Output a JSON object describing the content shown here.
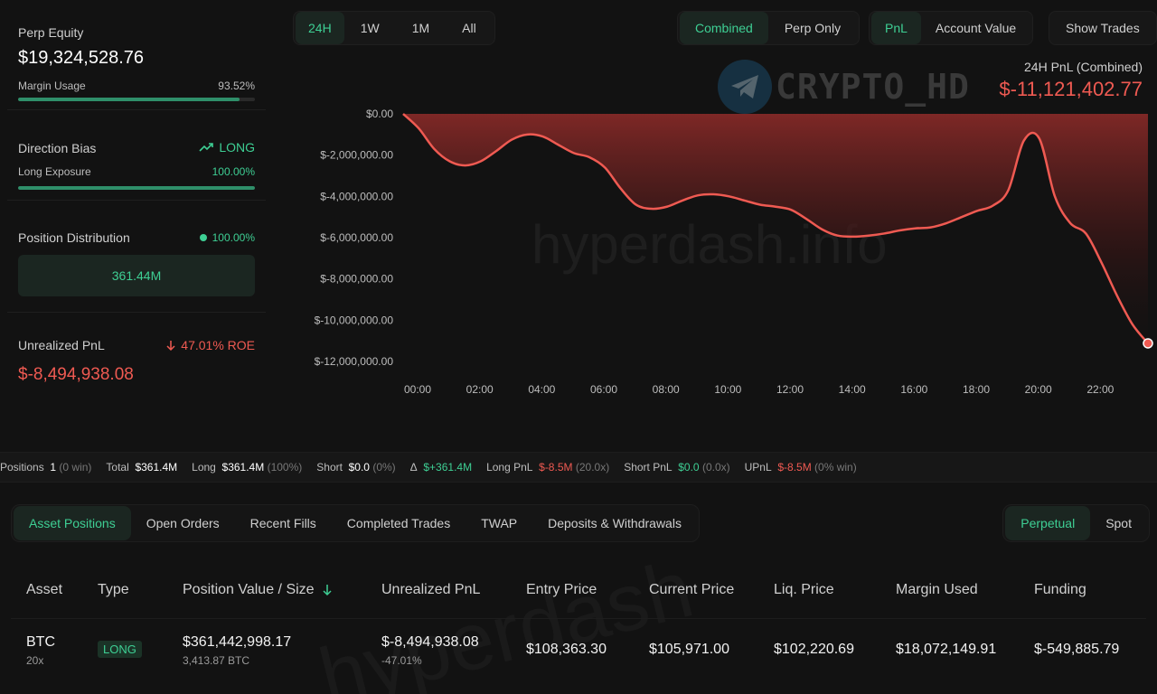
{
  "left": {
    "perp_equity_label": "Perp Equity",
    "perp_equity_value": "$19,324,528.76",
    "margin_usage_label": "Margin Usage",
    "margin_usage_value": "93.52%",
    "margin_usage_fraction": 0.9352,
    "direction_bias_label": "Direction Bias",
    "direction_bias_value": "LONG",
    "long_exposure_label": "Long Exposure",
    "long_exposure_value": "100.00%",
    "long_exposure_fraction": 1.0,
    "position_distribution_label": "Position Distribution",
    "position_distribution_value": "100.00%",
    "distribution_box_value": "361.44M",
    "unrealized_pnl_label": "Unrealized PnL",
    "roe_value": "47.01% ROE",
    "unrealized_pnl_value": "$-8,494,938.08"
  },
  "range_buttons": [
    "24H",
    "1W",
    "1M",
    "All"
  ],
  "range_active": "24H",
  "mode_buttons": [
    "Combined",
    "Perp Only"
  ],
  "mode_active": "Combined",
  "metric_buttons": [
    "PnL",
    "Account Value"
  ],
  "metric_active": "PnL",
  "show_trades_label": "Show Trades",
  "watermark": {
    "logo_text": "CRYPTO_HD",
    "site": "hyperdash.info",
    "site2": "hyperdash"
  },
  "pnl_header": {
    "title": "24H PnL (Combined)",
    "value": "$-11,121,402.77"
  },
  "chart_data": {
    "type": "area",
    "x": [
      "00:00",
      "00:30",
      "01:00",
      "01:30",
      "02:00",
      "02:30",
      "03:00",
      "03:30",
      "04:00",
      "04:30",
      "05:00",
      "05:30",
      "06:00",
      "06:30",
      "07:00",
      "07:30",
      "08:00",
      "08:30",
      "09:00",
      "09:30",
      "10:00",
      "10:30",
      "11:00",
      "11:30",
      "12:00",
      "12:30",
      "13:00",
      "13:30",
      "14:00",
      "14:30",
      "15:00",
      "15:30",
      "16:00",
      "16:30",
      "17:00",
      "17:30",
      "18:00",
      "18:30",
      "19:00",
      "19:30",
      "20:00",
      "20:30",
      "21:00",
      "21:30",
      "22:00",
      "22:30",
      "23:00",
      "23:30",
      "24:00"
    ],
    "values": [
      0,
      -700000,
      -1700000,
      -2300000,
      -2500000,
      -2300000,
      -1800000,
      -1250000,
      -1000000,
      -1100000,
      -1500000,
      -1900000,
      -2100000,
      -2600000,
      -3600000,
      -4400000,
      -4600000,
      -4500000,
      -4200000,
      -3950000,
      -3900000,
      -4000000,
      -4200000,
      -4400000,
      -4500000,
      -4650000,
      -5100000,
      -5600000,
      -5900000,
      -5950000,
      -5900000,
      -5800000,
      -5650000,
      -5550000,
      -5500000,
      -5300000,
      -5000000,
      -4700000,
      -4450000,
      -3700000,
      -1300000,
      -1200000,
      -4000000,
      -5300000,
      -5800000,
      -7200000,
      -8800000,
      -10200000,
      -11121402.77
    ],
    "ylim": [
      -12000000,
      0
    ],
    "yticks": [
      "$0.00",
      "$-2,000,000.00",
      "$-4,000,000.00",
      "$-6,000,000.00",
      "$-8,000,000.00",
      "$-10,000,000.00",
      "$-12,000,000.00"
    ],
    "xticks": [
      "00:00",
      "02:00",
      "04:00",
      "06:00",
      "08:00",
      "10:00",
      "12:00",
      "14:00",
      "16:00",
      "18:00",
      "20:00",
      "22:00"
    ],
    "color": "#ef5a52"
  },
  "stats": {
    "positions_label": "Positions",
    "positions_value": "1",
    "positions_win": "(0 win)",
    "total_label": "Total",
    "total_value": "$361.4M",
    "long_label": "Long",
    "long_value": "$361.4M",
    "long_pct": "(100%)",
    "short_label": "Short",
    "short_value": "$0.0",
    "short_pct": "(0%)",
    "delta_label": "Δ",
    "delta_value": "$+361.4M",
    "long_pnl_label": "Long PnL",
    "long_pnl_value": "$-8.5M",
    "long_pnl_x": "(20.0x)",
    "short_pnl_label": "Short PnL",
    "short_pnl_value": "$0.0",
    "short_pnl_x": "(0.0x)",
    "upnl_label": "UPnL",
    "upnl_value": "$-8.5M",
    "upnl_win": "(0% win)"
  },
  "tabs": [
    "Asset Positions",
    "Open Orders",
    "Recent Fills",
    "Completed Trades",
    "TWAP",
    "Deposits & Withdrawals"
  ],
  "tab_active": "Asset Positions",
  "market_tabs": [
    "Perpetual",
    "Spot"
  ],
  "market_active": "Perpetual",
  "table": {
    "headers": [
      "Asset",
      "Type",
      "Position Value / Size",
      "Unrealized PnL",
      "Entry Price",
      "Current Price",
      "Liq. Price",
      "Margin Used",
      "Funding"
    ],
    "row": {
      "asset": "BTC",
      "leverage": "20x",
      "type": "LONG",
      "position_value": "$361,442,998.17",
      "size": "3,413.87 BTC",
      "upnl": "$-8,494,938.08",
      "upnl_pct": "-47.01%",
      "entry": "$108,363.30",
      "current": "$105,971.00",
      "liq": "$102,220.69",
      "margin": "$18,072,149.91",
      "funding": "$-549,885.79"
    }
  }
}
